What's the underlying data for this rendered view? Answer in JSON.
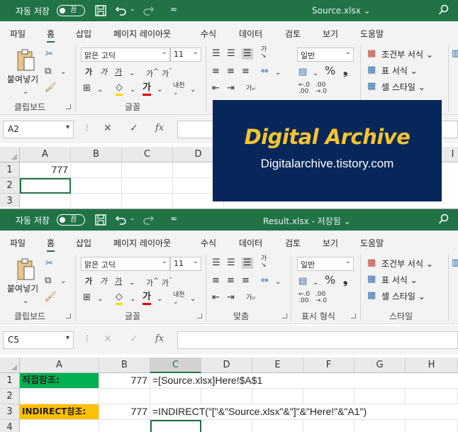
{
  "colors": {
    "excel_green": "#217346",
    "banner_bg": "#07275a",
    "banner_title": "#f4c430",
    "green_fill": "#00b050",
    "orange_fill": "#ffc000"
  },
  "window1": {
    "autosave_label": "자동 저장",
    "toggle_state": "끔",
    "filename": "Source.xlsx ⌄",
    "menu": [
      "파일",
      "홈",
      "삽입",
      "페이지 레이아웃",
      "수식",
      "데이터",
      "검토",
      "보기",
      "도움말"
    ],
    "ribbon": {
      "paste_label": "붙여넣기",
      "clipboard_label": "클립보드",
      "font_label": "글꼴",
      "font_name": "맑은 고딕",
      "font_size": "11",
      "number_format": "일반",
      "percent": "%",
      "comma": "❟",
      "cond_format": "조건부 서식 ⌄",
      "table_format": "표 서식 ⌄",
      "cell_style": "셀 스타일 ⌄"
    },
    "namebox": "A2",
    "columns": [
      "A",
      "B",
      "C",
      "D",
      "I"
    ],
    "rows": [
      "1",
      "2",
      "3"
    ],
    "cells": {
      "A1": "777"
    }
  },
  "banner": {
    "title": "Digital Archive",
    "url": "Digitalarchive.tistory.com"
  },
  "window2": {
    "autosave_label": "자동 저장",
    "toggle_state": "끔",
    "filename": "Result.xlsx  -  저장됨 ⌄",
    "menu": [
      "파일",
      "홈",
      "삽입",
      "페이지 레이아웃",
      "수식",
      "데이터",
      "검토",
      "보기",
      "도움말"
    ],
    "ribbon": {
      "paste_label": "붙여넣기",
      "clipboard_label": "클립보드",
      "font_label": "글꼴",
      "align_label": "맞춤",
      "number_label": "표시 형식",
      "style_label": "스타일",
      "font_name": "맑은 고딕",
      "font_size": "11",
      "number_format": "일반",
      "percent": "%",
      "comma": "❟",
      "cond_format": "조건부 서식 ⌄",
      "table_format": "표 서식 ⌄",
      "cell_style": "셀 스타일 ⌄"
    },
    "namebox": "C5",
    "columns": [
      "A",
      "B",
      "C",
      "D",
      "E",
      "F",
      "G",
      "H"
    ],
    "rows": [
      "1",
      "2",
      "3",
      "4"
    ],
    "cells": {
      "A1": "직접참조:",
      "B1": "777",
      "C1": "=[Source.xlsx]Here!$A$1",
      "A3": "INDIRECT참조:",
      "B3": "777",
      "C3": "=INDIRECT(\"[\"&\"Source.xlsx\"&\"]\"&\"Here!\"&\"A1\")"
    }
  }
}
